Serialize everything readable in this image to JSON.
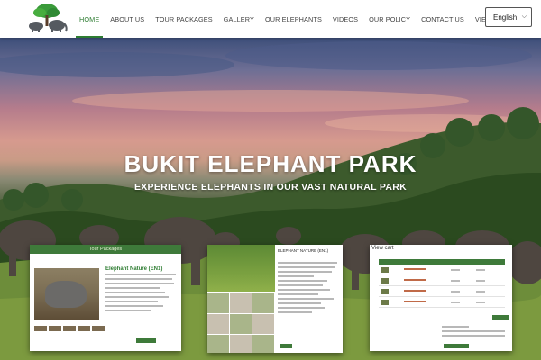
{
  "brand": {
    "logo_icon": "elephant-tree-logo"
  },
  "nav": {
    "items": [
      {
        "label": "HOME",
        "active": true
      },
      {
        "label": "ABOUT US",
        "active": false
      },
      {
        "label": "TOUR PACKAGES",
        "active": false
      },
      {
        "label": "GALLERY",
        "active": false
      },
      {
        "label": "OUR ELEPHANTS",
        "active": false
      },
      {
        "label": "VIDEOS",
        "active": false
      },
      {
        "label": "OUR POLICY",
        "active": false
      },
      {
        "label": "CONTACT US",
        "active": false
      },
      {
        "label": "VIEW CART",
        "active": false
      }
    ]
  },
  "language": {
    "selected": "English"
  },
  "hero": {
    "title": "BUKIT ELEPHANT PARK",
    "subtitle": "EXPERIENCE ELEPHANTS IN OUR VAST NATURAL PARK"
  },
  "previews": {
    "tour_packages": {
      "header": "Tour Packages",
      "item_title": "Elephant Nature (EN1)"
    },
    "package_detail": {
      "title": "ELEPHANT NATURE (EN1)"
    },
    "cart": {
      "title": "View cart"
    }
  },
  "colors": {
    "accent": "#2e7d32",
    "header_bg": "#ffffff"
  }
}
